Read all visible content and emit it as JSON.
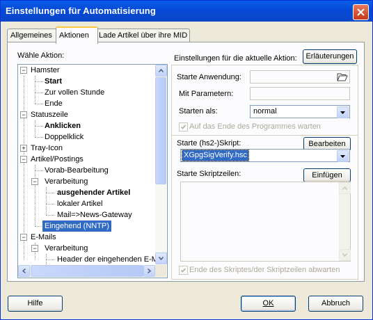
{
  "window": {
    "title": "Einstellungen für Automatisierung"
  },
  "tabs": [
    {
      "label": "Allgemeines",
      "active": false
    },
    {
      "label": "Aktionen",
      "active": true
    },
    {
      "label": "Lade Artikel über ihre MID",
      "active": false
    }
  ],
  "left": {
    "heading": "Wähle Aktion:",
    "tree": [
      {
        "label": "Hamster",
        "level": 0,
        "expander": "minus"
      },
      {
        "label": "Start",
        "level": 1,
        "bold": true
      },
      {
        "label": "Zur vollen Stunde",
        "level": 1
      },
      {
        "label": "Ende",
        "level": 1
      },
      {
        "label": "Statuszeile",
        "level": 0,
        "expander": "minus"
      },
      {
        "label": "Anklicken",
        "level": 1,
        "bold": true
      },
      {
        "label": "Doppelklick",
        "level": 1
      },
      {
        "label": "Tray-Icon",
        "level": 0,
        "expander": "plus"
      },
      {
        "label": "Artikel/Postings",
        "level": 0,
        "expander": "minus"
      },
      {
        "label": "Vorab-Bearbeitung",
        "level": 1
      },
      {
        "label": "Verarbeitung",
        "level": 1,
        "expander": "minus"
      },
      {
        "label": "ausgehender Artikel",
        "level": 2,
        "bold": true
      },
      {
        "label": "lokaler Artikel",
        "level": 2
      },
      {
        "label": "Mail=>News-Gateway",
        "level": 2
      },
      {
        "label": "Eingehend (NNTP)",
        "level": 1,
        "selected": true
      },
      {
        "label": "E-Mails",
        "level": 0,
        "expander": "minus"
      },
      {
        "label": "Verarbeitung",
        "level": 1,
        "expander": "minus"
      },
      {
        "label": "Header der eingehenden E-M",
        "level": 2
      }
    ]
  },
  "right": {
    "heading": "Einstellungen für die aktuelle Aktion:",
    "help_button": "Erläuterungen",
    "app_label": "Starte Anwendung:",
    "app_value": "",
    "params_label": "Mit Parametern:",
    "params_value": "",
    "start_as_label": "Starten als:",
    "start_as_value": "normal",
    "wait_label": "Auf das Ende des Programmes warten",
    "script_label": "Starte (hs2-)Skript:",
    "edit_button": "Bearbeiten",
    "script_value": "XGpgSigVerify.hsc",
    "lines_label": "Starte Skriptzeilen:",
    "insert_button": "Einfügen",
    "wait_script_label": "Ende des Skriptes/der Skriptzeilen abwarten"
  },
  "footer": {
    "help": "Hilfe",
    "ok": "OK",
    "cancel": "Abbruch"
  },
  "colors": {
    "titlebar": "#0449d6",
    "selection": "#316ac5",
    "tab_highlight": "#ffc83c"
  }
}
